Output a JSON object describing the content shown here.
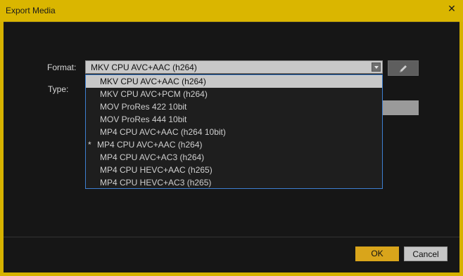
{
  "window": {
    "title": "Export Media"
  },
  "form": {
    "format_label": "Format:",
    "type_label": "Type:",
    "format_value": "MKV CPU AVC+AAC (h264)"
  },
  "dropdown": {
    "options": [
      {
        "label": "MKV CPU AVC+AAC (h264)",
        "selected": true,
        "marked": false
      },
      {
        "label": "MKV CPU AVC+PCM (h264)",
        "selected": false,
        "marked": false
      },
      {
        "label": "MOV ProRes 422 10bit",
        "selected": false,
        "marked": false
      },
      {
        "label": "MOV ProRes 444 10bit",
        "selected": false,
        "marked": false
      },
      {
        "label": "MP4 CPU AVC+AAC (h264 10bit)",
        "selected": false,
        "marked": false
      },
      {
        "label": "MP4 CPU AVC+AAC (h264)",
        "selected": false,
        "marked": true
      },
      {
        "label": "MP4 CPU AVC+AC3 (h264)",
        "selected": false,
        "marked": false
      },
      {
        "label": "MP4 CPU HEVC+AAC (h265)",
        "selected": false,
        "marked": false
      },
      {
        "label": "MP4 CPU HEVC+AC3 (h265)",
        "selected": false,
        "marked": false
      }
    ],
    "marker": "*"
  },
  "buttons": {
    "ok": "OK",
    "cancel": "Cancel"
  },
  "colors": {
    "accent": "#d9a51b",
    "frame": "#d6b200",
    "highlight_border": "#3d7fd1"
  }
}
